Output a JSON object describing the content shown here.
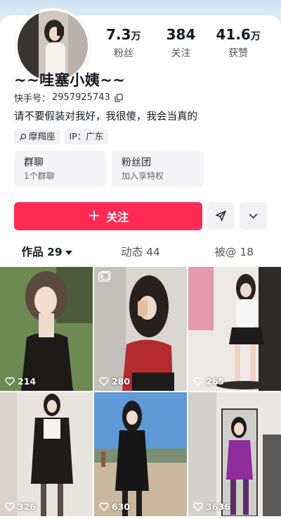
{
  "profile": {
    "name": "~~哇塞小姨~~",
    "id_label": "快手号：",
    "id_value": "2957925743",
    "bio": "请不要假装对我好，我很傻，我会当真的",
    "tags": [
      {
        "icon": "search-icon",
        "label": "摩羯座"
      },
      {
        "icon": "",
        "label": "IP：广东"
      }
    ]
  },
  "stats": [
    {
      "value": "7.3",
      "unit": "万",
      "label": "粉丝"
    },
    {
      "value": "384",
      "unit": "",
      "label": "关注"
    },
    {
      "value": "41.6",
      "unit": "万",
      "label": "获赞"
    }
  ],
  "features": [
    {
      "title": "群聊",
      "subtitle": "1个群聊"
    },
    {
      "title": "粉丝团",
      "subtitle": "加入享特权"
    }
  ],
  "actions": {
    "follow_label": "关注",
    "share_icon": "send-icon",
    "more_icon": "chevron-down-icon"
  },
  "tabs": [
    {
      "label": "作品 29",
      "active": true
    },
    {
      "label": "动态 44",
      "active": false
    },
    {
      "label": "被@ 18",
      "active": false
    }
  ],
  "videos": [
    {
      "likes": "214"
    },
    {
      "likes": "280",
      "badge": "album-icon"
    },
    {
      "likes": "265"
    },
    {
      "likes": "326"
    },
    {
      "likes": "630"
    },
    {
      "likes": "3636"
    }
  ],
  "colors": {
    "accent": "#fe2c55",
    "banner": "#dbe9f6"
  }
}
